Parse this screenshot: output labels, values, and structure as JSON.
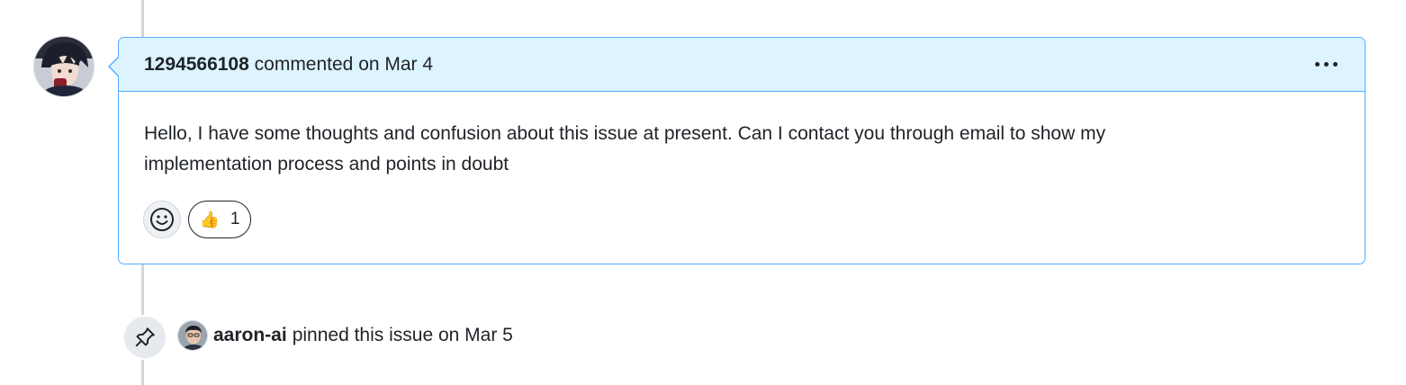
{
  "comment": {
    "author": "1294566108",
    "meta": "commented on Mar 4",
    "body": "Hello, I have some thoughts and confusion about this issue at present. Can I contact you through email to show my implementation process and points in doubt",
    "icons": {
      "more": "kebab-horizontal-icon",
      "add_reaction": "smiley-icon"
    },
    "reactions": [
      {
        "emoji": "👍",
        "count": "1"
      }
    ]
  },
  "event": {
    "actor": "aaron-ai",
    "action": "pinned this issue on Mar 5",
    "icon": "pin-icon"
  },
  "colors": {
    "header_bg": "#ddf4ff",
    "accent_border": "#54aeff",
    "timeline": "#d0d7de",
    "badge_bg": "#e6eaef"
  }
}
